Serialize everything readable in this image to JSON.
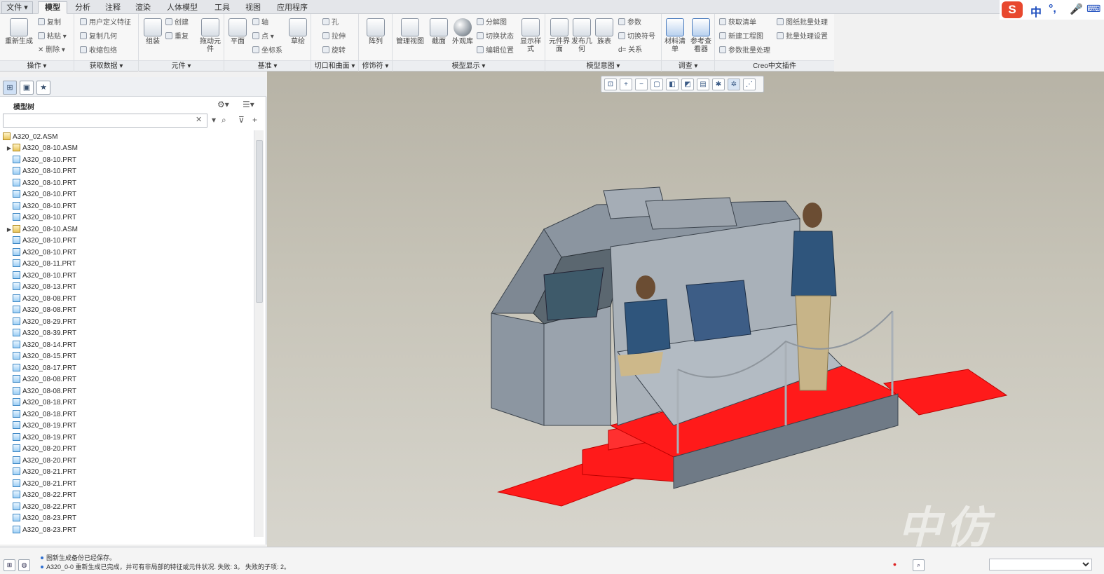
{
  "menu_tabs": [
    {
      "label": "文件 ▾"
    },
    {
      "label": "模型"
    },
    {
      "label": "分析"
    },
    {
      "label": "注释"
    },
    {
      "label": "渲染"
    },
    {
      "label": "人体模型"
    },
    {
      "label": "工具"
    },
    {
      "label": "视图"
    },
    {
      "label": "应用程序"
    }
  ],
  "ribbon": {
    "groups": [
      {
        "label": "操作 ▾"
      },
      {
        "label": "获取数据 ▾"
      },
      {
        "label": "元件 ▾"
      },
      {
        "label": "基准 ▾"
      },
      {
        "label": "切口和曲面 ▾"
      },
      {
        "label": "修饰符 ▾"
      },
      {
        "label": "模型显示 ▾"
      },
      {
        "label": "模型意图 ▾"
      },
      {
        "label": "调查 ▾"
      },
      {
        "label": "Creo中文插件"
      }
    ],
    "operations": {
      "regenerate": "重新生成",
      "copy": "复制",
      "paste": "粘贴 ▾",
      "delete": "✕ 删除 ▾"
    },
    "get_data": {
      "user_feature": "用户定义特征",
      "copy_geom": "复制几何",
      "shrinkwrap": "收缩包络"
    },
    "component": {
      "assemble": "组装",
      "create": "创建",
      "repeat": "重复"
    },
    "datum": {
      "drag": "拖动元件",
      "plane": "平面",
      "axis": "轴",
      "point": "点 ▾",
      "csys": "坐标系",
      "sketch": "草绘"
    },
    "cuts": {
      "hole": "孔",
      "extrude": "拉伸",
      "revolve": "旋转"
    },
    "modifiers": {
      "pattern": "阵列"
    },
    "model_display": {
      "manage_views": "管理视图",
      "section": "截面",
      "appearance": "外观库",
      "exploded": "分解图",
      "toggle_state": "切换状态",
      "edit_position": "编辑位置",
      "display_style": "显示样式"
    },
    "model_intent": {
      "component_interface": "元件界面",
      "publish_geom": "发布几何",
      "table": "族表",
      "params": "参数",
      "switch_symbol": "切换符号",
      "relations": "d= 关系"
    },
    "investigate": {
      "bom": "材料清单",
      "reference_viewer": "参考查看器"
    },
    "creo_plugin": {
      "get_list": "获取清单",
      "new_drawing": "新建工程图",
      "param_batch": "参数批量处理",
      "drawing_batch": "图纸批量处理",
      "batch_settings": "批量处理设置"
    }
  },
  "ime": {
    "lang": "中",
    "punct": "°,",
    "logo": "S"
  },
  "model_tree": {
    "title": "模型树",
    "search_placeholder": "",
    "clear": "✕",
    "root": "A320_02.ASM",
    "items": [
      {
        "name": "A320_08-10.ASM",
        "type": "asm",
        "expandable": true
      },
      {
        "name": "A320_08-10.PRT",
        "type": "prt"
      },
      {
        "name": "A320_08-10.PRT",
        "type": "prt"
      },
      {
        "name": "A320_08-10.PRT",
        "type": "prt"
      },
      {
        "name": "A320_08-10.PRT",
        "type": "prt"
      },
      {
        "name": "A320_08-10.PRT",
        "type": "prt"
      },
      {
        "name": "A320_08-10.PRT",
        "type": "prt"
      },
      {
        "name": "A320_08-10.ASM",
        "type": "asm",
        "expandable": true
      },
      {
        "name": "A320_08-10.PRT",
        "type": "prt"
      },
      {
        "name": "A320_08-10.PRT",
        "type": "prt"
      },
      {
        "name": "A320_08-11.PRT",
        "type": "prt"
      },
      {
        "name": "A320_08-10.PRT",
        "type": "prt"
      },
      {
        "name": "A320_08-13.PRT",
        "type": "prt"
      },
      {
        "name": "A320_08-08.PRT",
        "type": "prt"
      },
      {
        "name": "A320_08-08.PRT",
        "type": "prt"
      },
      {
        "name": "A320_08-29.PRT",
        "type": "prt"
      },
      {
        "name": "A320_08-39.PRT",
        "type": "prt"
      },
      {
        "name": "A320_08-14.PRT",
        "type": "prt"
      },
      {
        "name": "A320_08-15.PRT",
        "type": "prt"
      },
      {
        "name": "A320_08-17.PRT",
        "type": "prt"
      },
      {
        "name": "A320_08-08.PRT",
        "type": "prt"
      },
      {
        "name": "A320_08-08.PRT",
        "type": "prt"
      },
      {
        "name": "A320_08-18.PRT",
        "type": "prt"
      },
      {
        "name": "A320_08-18.PRT",
        "type": "prt"
      },
      {
        "name": "A320_08-19.PRT",
        "type": "prt"
      },
      {
        "name": "A320_08-19.PRT",
        "type": "prt"
      },
      {
        "name": "A320_08-20.PRT",
        "type": "prt"
      },
      {
        "name": "A320_08-20.PRT",
        "type": "prt"
      },
      {
        "name": "A320_08-21.PRT",
        "type": "prt"
      },
      {
        "name": "A320_08-21.PRT",
        "type": "prt"
      },
      {
        "name": "A320_08-22.PRT",
        "type": "prt"
      },
      {
        "name": "A320_08-22.PRT",
        "type": "prt"
      },
      {
        "name": "A320_08-23.PRT",
        "type": "prt"
      },
      {
        "name": "A320_08-23.PRT",
        "type": "prt"
      }
    ]
  },
  "watermark": "中仿",
  "status": {
    "messages": [
      "图新生成备份已经保存。",
      "A320_0-0 重新生成已完成，并可有非局部的特征或元件状况. 失败: 3。 失败的子项: 2。"
    ]
  },
  "colors": {
    "accent": "#2f6fd0",
    "platform_red": "#ff1a1a",
    "model_grey": "#7f8a96",
    "viewport_bg": "#c7c4b8"
  }
}
